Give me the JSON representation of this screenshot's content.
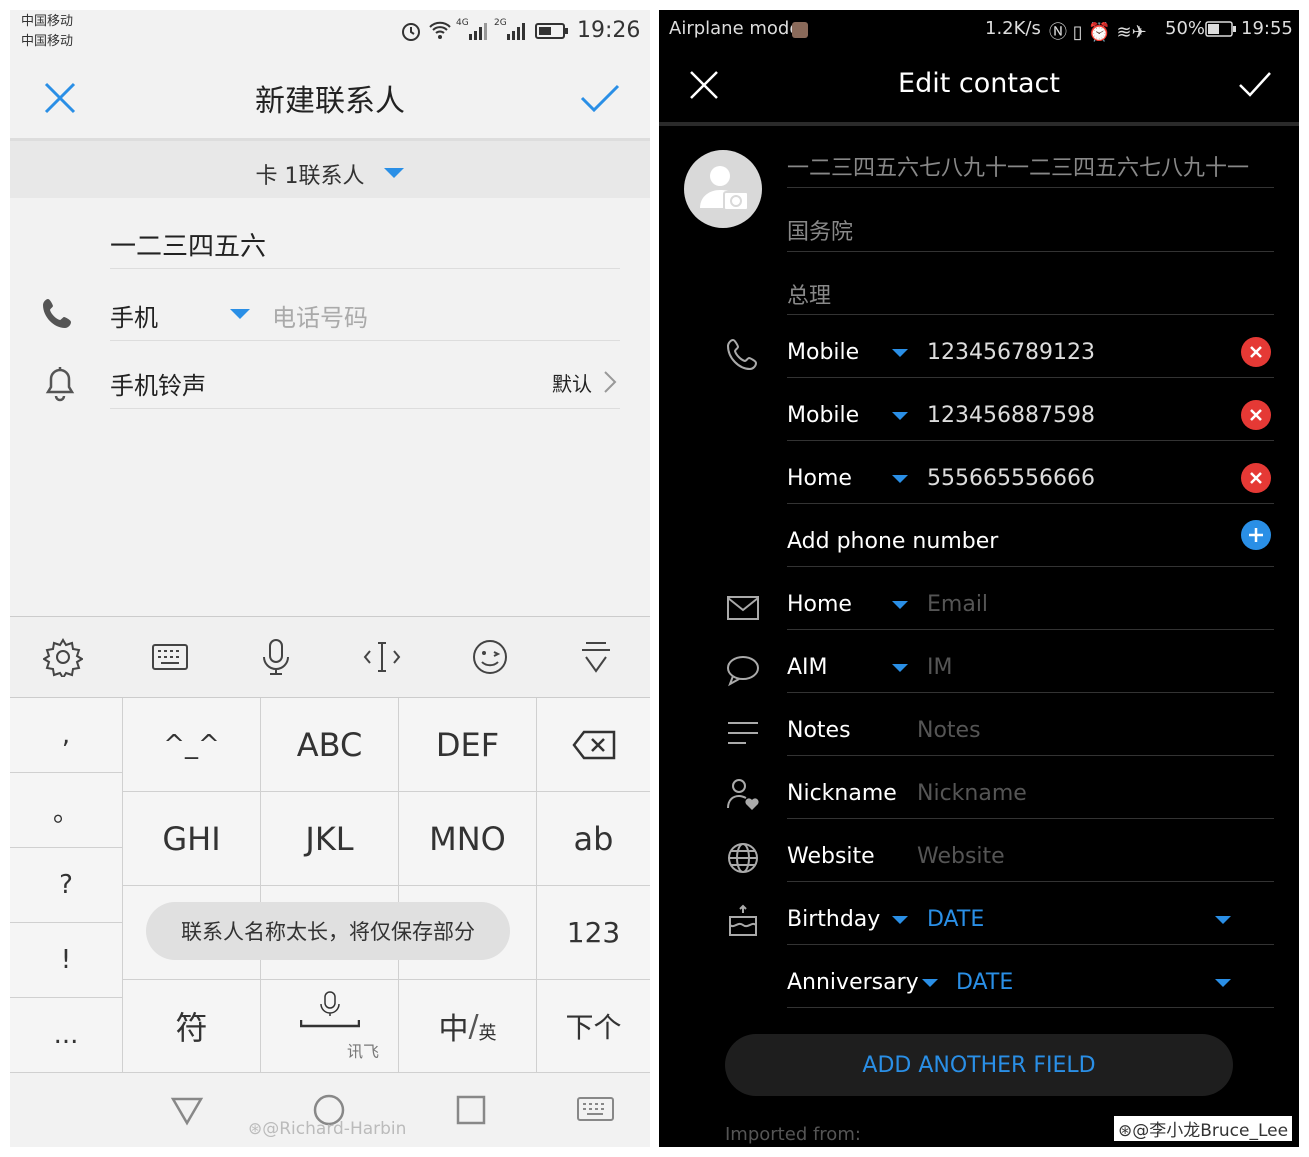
{
  "left": {
    "status": {
      "carrier1": "中国移动",
      "carrier2": "中国移动",
      "net1": "4G",
      "net2": "2G",
      "time": "19:26"
    },
    "header": {
      "title": "新建联系人"
    },
    "account": {
      "label": "卡 1联系人"
    },
    "name_value": "一二三四五六",
    "phone": {
      "type": "手机",
      "placeholder": "电话号码"
    },
    "ringtone": {
      "label": "手机铃声",
      "value": "默认"
    },
    "keyboard": {
      "left_keys": [
        ",",
        "。",
        "?",
        "!",
        "..."
      ],
      "grid": [
        [
          "^_^",
          "ABC",
          "DEF"
        ],
        [
          "GHI",
          "JKL",
          "MNO"
        ]
      ],
      "right_keys": [
        "ab",
        "123",
        "下个"
      ],
      "bottom": {
        "symbols": "符",
        "voice_label": "讯飞",
        "lang_main": "中",
        "lang_sub": "英"
      },
      "toast": "联系人名称太长，将仅保存部分"
    },
    "watermark": "@Richard-Harbin"
  },
  "right": {
    "status": {
      "mode": "Airplane mode",
      "speed": "1.2K/s",
      "battery": "50%",
      "time": "19:55"
    },
    "header": {
      "title": "Edit contact"
    },
    "name_value": "一二三四五六七八九十一二三四五六七八九十一",
    "company": "国务院",
    "job_title": "总理",
    "phones": [
      {
        "type": "Mobile",
        "number": "123456789123"
      },
      {
        "type": "Mobile",
        "number": "123456887598"
      },
      {
        "type": "Home",
        "number": "555665556666"
      }
    ],
    "add_phone": "Add phone number",
    "email": {
      "type": "Home",
      "placeholder": "Email"
    },
    "im": {
      "type": "AIM",
      "placeholder": "IM"
    },
    "notes": {
      "label": "Notes",
      "placeholder": "Notes"
    },
    "nickname": {
      "label": "Nickname",
      "placeholder": "Nickname"
    },
    "website": {
      "label": "Website",
      "placeholder": "Website"
    },
    "birthday": {
      "label": "Birthday",
      "value": "DATE"
    },
    "anniversary": {
      "label": "Anniversary",
      "value": "DATE"
    },
    "add_field": "ADD ANOTHER FIELD",
    "imported": "Imported from:"
  },
  "credit": "@李小龙Bruce_Lee",
  "colors": {
    "accent": "#2a8fe6",
    "danger": "#e53935",
    "dark_bg": "#000000",
    "light_bg": "#f2f2f2"
  }
}
